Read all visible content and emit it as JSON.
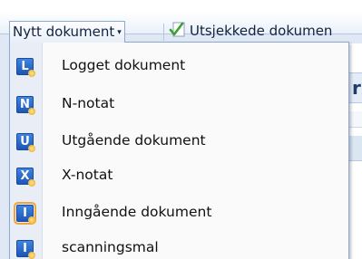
{
  "toolbar": {
    "new_document_menu": "Nytt dokument",
    "new_document_caret": "▾",
    "checkout_button": "Utsjekkede dokumen"
  },
  "background": {
    "header_fragment": "r"
  },
  "menu": {
    "items": [
      {
        "icon": "L",
        "icon_name": "logget-document-icon",
        "label": "Logget dokument"
      },
      {
        "icon": "N",
        "icon_name": "n-notat-icon",
        "label": "N-notat"
      },
      {
        "icon": "U",
        "icon_name": "utgaende-document-icon",
        "label": "Utgående dokument"
      },
      {
        "icon": "X",
        "icon_name": "x-notat-icon",
        "label": "X-notat"
      },
      {
        "icon": "I",
        "icon_name": "inngaende-document-icon",
        "label": "Inngående dokument"
      },
      {
        "icon": "I",
        "icon_name": "scanningsmal-icon",
        "label": "scanningsmal"
      }
    ]
  },
  "colors": {
    "icon_blue": "#1d56b8",
    "menu_border": "#8ea9cf",
    "gutter": "#e9eef6"
  }
}
